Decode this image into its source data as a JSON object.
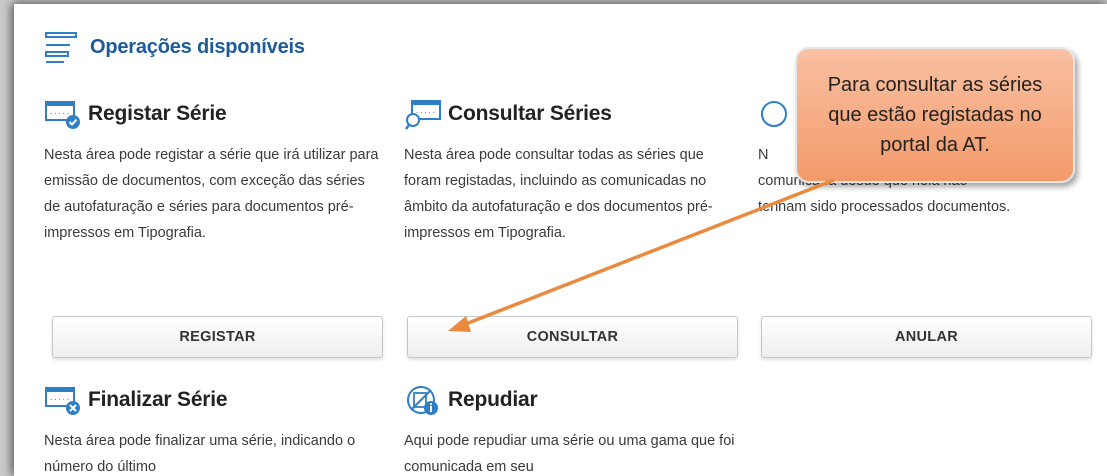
{
  "section": {
    "title": "Operações disponíveis"
  },
  "cards": [
    {
      "title": "Registar Série",
      "description": "Nesta área pode registar a série que irá utilizar para emissão de documentos, com exceção das séries de autofaturação e séries para documentos pré-impressos em Tipografia.",
      "button": "REGISTAR",
      "icon": "register-series-icon"
    },
    {
      "title": "Consultar Séries",
      "description": "Nesta área pode consultar todas as séries que foram registadas, incluindo as comunicadas no âmbito da autofaturação e dos documentos pré-impressos em Tipografia.",
      "button": "CONSULTAR",
      "icon": "consult-series-icon"
    },
    {
      "title": "",
      "description_visible": "N comunicada desde que nela não tenham sido processados documentos.",
      "desc_line1": "N",
      "desc_line2": "comunicada desde que nela não",
      "desc_line3": "tenham sido processados documentos.",
      "button": "ANULAR",
      "icon": "cancel-series-icon"
    },
    {
      "title": "Finalizar Série",
      "description": "Nesta área pode finalizar uma série, indicando o número do último",
      "icon": "finalize-series-icon"
    },
    {
      "title": "Repudiar",
      "description": "Aqui pode repudiar uma série ou uma gama que foi comunicada em seu",
      "icon": "repudiate-icon"
    }
  ],
  "callout": {
    "text": "Para consultar as séries que estão registadas no portal da AT."
  },
  "colors": {
    "title_blue": "#1d5b9a",
    "icon_blue": "#2f7fc4",
    "callout_orange": "#f39a6a",
    "arrow_orange": "#ea8a3f"
  }
}
